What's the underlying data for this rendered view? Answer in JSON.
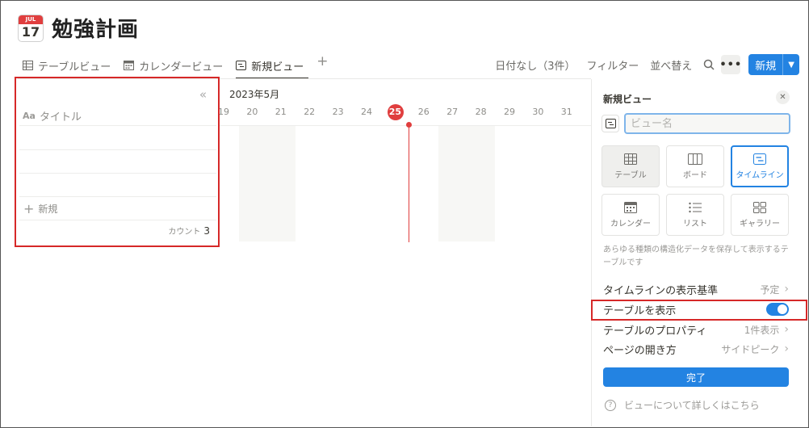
{
  "page": {
    "title": "勉強計画",
    "icon": {
      "name": "calendar-icon",
      "month": "JUL",
      "day": "17"
    }
  },
  "tabs": [
    {
      "label": "テーブルビュー",
      "icon": "table-icon"
    },
    {
      "label": "カレンダービュー",
      "icon": "calendar-icon"
    },
    {
      "label": "新規ビュー",
      "icon": "timeline-icon",
      "active": true
    }
  ],
  "toolbar": {
    "no_date": "日付なし（3件）",
    "filter": "フィルター",
    "sort": "並べ替え",
    "more": "•••",
    "new_label": "新規"
  },
  "timeline": {
    "month": "2023年5月",
    "days": [
      "19",
      "20",
      "21",
      "22",
      "23",
      "24",
      "25",
      "26",
      "27",
      "28",
      "29",
      "30",
      "31"
    ],
    "today": "25"
  },
  "table": {
    "collapse_icon": "«",
    "title_prefix": "Aa",
    "title_header": "タイトル",
    "add_new": "新規",
    "count_label": "カウント",
    "count_value": "3"
  },
  "side_panel": {
    "title": "新規ビュー",
    "name_placeholder": "ビュー名",
    "layouts": [
      {
        "label": "テーブル",
        "icon": "table-icon",
        "state": "hover"
      },
      {
        "label": "ボード",
        "icon": "board-icon",
        "state": ""
      },
      {
        "label": "タイムライン",
        "icon": "timeline-icon",
        "state": "selected"
      },
      {
        "label": "カレンダー",
        "icon": "calendar-icon",
        "state": ""
      },
      {
        "label": "リスト",
        "icon": "list-icon",
        "state": ""
      },
      {
        "label": "ギャラリー",
        "icon": "gallery-icon",
        "state": ""
      }
    ],
    "description": "あらゆる種類の構造化データを保存して表示するテーブルです",
    "props": {
      "timeline_basis_label": "タイムラインの表示基準",
      "timeline_basis_value": "予定",
      "show_table_label": "テーブルを表示",
      "show_table_on": true,
      "table_props_label": "テーブルのプロパティ",
      "table_props_value": "1件表示",
      "page_open_label": "ページの開き方",
      "page_open_value": "サイドピーク"
    },
    "done": "完了",
    "help": "ビューについて詳しくはこちら"
  },
  "colors": {
    "accent": "#2383e2",
    "today": "#e03e3e",
    "highlight": "#d62828"
  }
}
